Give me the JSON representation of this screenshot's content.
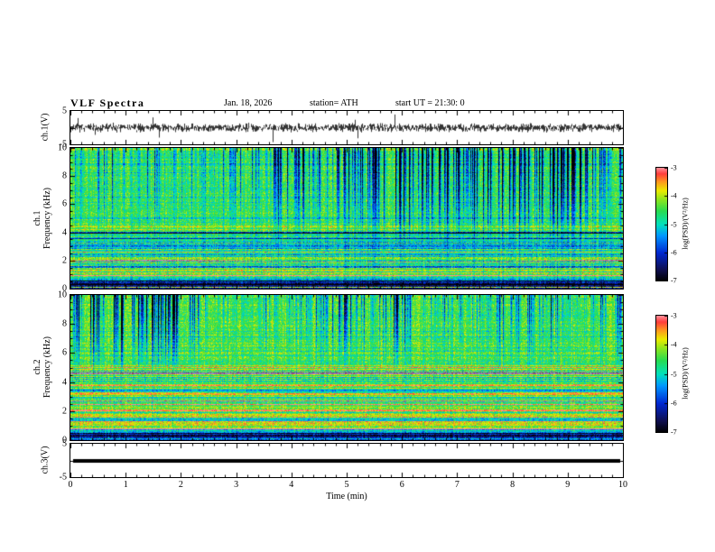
{
  "title": "VLF Spectra",
  "header": {
    "date": "Jan. 18, 2026",
    "station": "station= ATH",
    "start_ut": "start UT =  21:30: 0"
  },
  "axes": {
    "x": {
      "label": "Time (min)",
      "min": 0,
      "max": 10,
      "ticks": [
        "0",
        "1",
        "2",
        "3",
        "4",
        "5",
        "6",
        "7",
        "8",
        "9",
        "10"
      ]
    },
    "spec_y_ticks": [
      "10",
      "8",
      "6",
      "4",
      "2",
      "0"
    ],
    "wave_y_ticks": [
      "5",
      "-5"
    ],
    "colorbar_ticks": [
      "-3",
      "-4",
      "-5",
      "-6",
      "-7"
    ]
  },
  "colorbar": {
    "label": "log(PSD)/(V²/Hz)",
    "max": -3,
    "min": -7
  },
  "panels": {
    "wave1": {
      "ylabel": "ch.1(V)",
      "ymin": -5,
      "ymax": 5
    },
    "spec1": {
      "ylabel_line1": "ch.1",
      "ylabel_line2": "Frequency (kHz)",
      "ymin": 0,
      "ymax": 10
    },
    "spec2": {
      "ylabel_line1": "ch.2",
      "ylabel_line2": "Frequency (kHz)",
      "ymin": 0,
      "ymax": 10
    },
    "wave3": {
      "ylabel": "ch.3(V)",
      "ymin": -5,
      "ymax": 5
    }
  },
  "chart_data": [
    {
      "type": "line",
      "name": "ch1_waveform",
      "ylabel": "ch.1(V)",
      "ylim": [
        -5,
        5
      ],
      "yticks": [
        5,
        -5
      ],
      "xlim": [
        0,
        10
      ],
      "description": "Dense broadband noise trace centered on 0 V, typical envelope about ±1 V with frequent impulsive spikes reaching roughly ±3 to ±4 V over the full 10 minute record."
    },
    {
      "type": "heatmap",
      "name": "ch1_spectrogram",
      "ylabel": "ch.1 Frequency (kHz)",
      "ylim": [
        0,
        10
      ],
      "yticks": [
        0,
        2,
        4,
        6,
        8,
        10
      ],
      "xlim": [
        0,
        10
      ],
      "xlabel": "Time (min)",
      "colorbar": {
        "label": "log(PSD)/(V²/Hz)",
        "min": -7,
        "max": -3
      },
      "background_level": -4.5,
      "vertical_streaks": "Dense dark-blue/black vertical dropout streaks dominating above ~3.5 kHz (impulsive sferics), on a green/cyan background near -4.5.",
      "features": [
        {
          "f": 0.35,
          "hw": 0.5,
          "delta": -3.0,
          "note": "near-DC black band 0-0.7 kHz"
        },
        {
          "f": 0.15,
          "hw": 0.07,
          "delta": 2.2,
          "note": "thin bright line inside bottom band"
        },
        {
          "f": 0.95,
          "hw": 0.07,
          "delta": 1.4,
          "note": "bright green line ~1 kHz"
        },
        {
          "f": 1.35,
          "hw": 0.05,
          "delta": 0.7
        },
        {
          "f": 2.05,
          "hw": 0.06,
          "delta": 2.2,
          "intermittent": true,
          "note": "intermittent red/orange line ~2 kHz"
        },
        {
          "f": 2.45,
          "hw": 0.12,
          "delta": -1.0
        },
        {
          "f": 3.05,
          "hw": 0.3,
          "delta": -1.5,
          "note": "dark blue band ~2.8-3.4 kHz"
        },
        {
          "f": 3.6,
          "hw": 0.12,
          "delta": -0.7
        },
        {
          "f": 4.0,
          "hw": 0.18,
          "delta": -1.1,
          "note": "dark band ~4 kHz"
        },
        {
          "f": 4.45,
          "hw": 0.07,
          "delta": 0.7
        },
        {
          "f": 5.05,
          "hw": 0.1,
          "delta": -0.6
        },
        {
          "f": 9.9,
          "hw": 0.12,
          "delta": 0.7,
          "note": "bright edge line near 10 kHz"
        }
      ]
    },
    {
      "type": "heatmap",
      "name": "ch2_spectrogram",
      "ylabel": "ch.2 Frequency (kHz)",
      "ylim": [
        0,
        10
      ],
      "yticks": [
        0,
        2,
        4,
        6,
        8,
        10
      ],
      "xlim": [
        0,
        10
      ],
      "xlabel": "Time (min)",
      "colorbar": {
        "label": "log(PSD)/(V²/Hz)",
        "min": -7,
        "max": -3
      },
      "background_level": -4.4,
      "vertical_streaks": "Dark-blue/black vertical streaks mostly above ~5 kHz; strong colorful horizontal striping (red/yellow/cyan lines) below ~5 kHz.",
      "features": [
        {
          "f": 0.35,
          "hw": 0.5,
          "delta": -3.0,
          "note": "near-DC black band"
        },
        {
          "f": 0.15,
          "hw": 0.07,
          "delta": 2.2
        },
        {
          "f": 0.8,
          "hw": 0.06,
          "delta": 2.3,
          "note": "red line ~0.8 kHz"
        },
        {
          "f": 1.15,
          "hw": 0.05,
          "delta": 1.2
        },
        {
          "f": 1.55,
          "hw": 0.05,
          "delta": -0.8
        },
        {
          "f": 1.85,
          "hw": 0.05,
          "delta": 1.0
        },
        {
          "f": 2.1,
          "hw": 0.07,
          "delta": 2.3,
          "note": "red/orange line ~2.1 kHz"
        },
        {
          "f": 2.5,
          "hw": 0.06,
          "delta": 1.1
        },
        {
          "f": 2.9,
          "hw": 0.09,
          "delta": -0.9
        },
        {
          "f": 3.3,
          "hw": 0.06,
          "delta": 1.6,
          "intermittent": true
        },
        {
          "f": 3.8,
          "hw": 0.07,
          "delta": 0.9
        },
        {
          "f": 4.2,
          "hw": 0.1,
          "delta": -0.7
        },
        {
          "f": 4.6,
          "hw": 0.05,
          "delta": 1.4
        },
        {
          "f": 5.3,
          "hw": 0.1,
          "delta": -0.5
        },
        {
          "f": 9.9,
          "hw": 0.1,
          "delta": 0.5
        }
      ]
    },
    {
      "type": "line",
      "name": "ch3_waveform",
      "ylabel": "ch.3(V)",
      "ylim": [
        -5,
        5
      ],
      "yticks": [
        5,
        -5
      ],
      "xlim": [
        0,
        10
      ],
      "values_constant": 0,
      "description": "Flat thick black line at 0 V for the entire record (channel flat/off)."
    }
  ]
}
